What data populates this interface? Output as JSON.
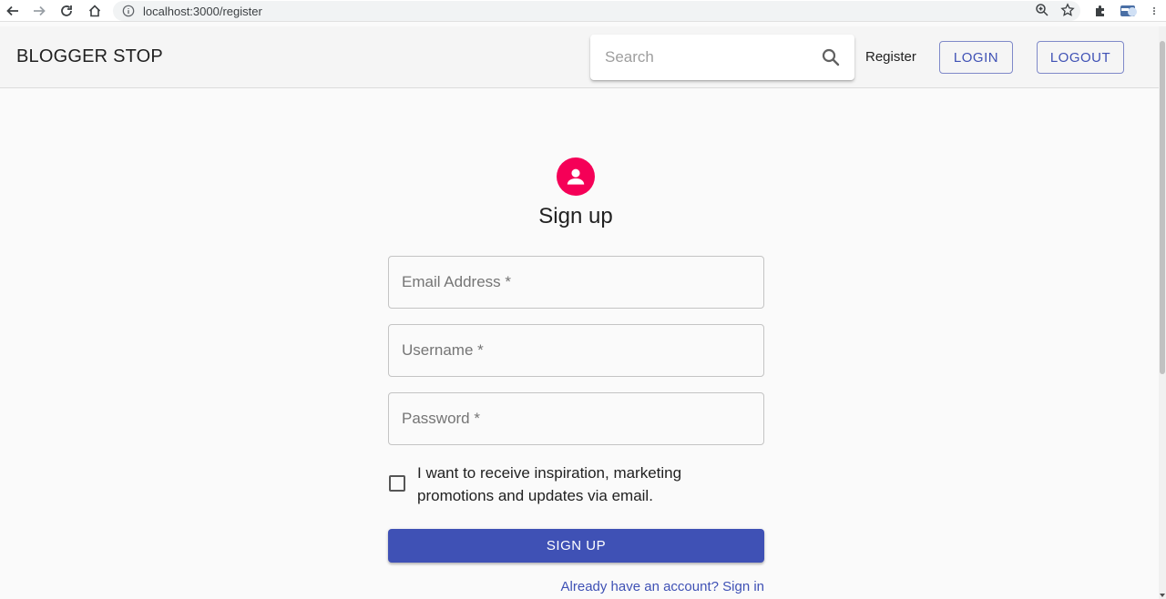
{
  "browser": {
    "url": "localhost:3000/register",
    "icons": [
      "back-icon",
      "forward-icon",
      "reload-icon",
      "home-icon",
      "info-icon",
      "zoom-icon",
      "star-icon",
      "extensions-icon",
      "profile-icon",
      "menu-icon"
    ]
  },
  "appbar": {
    "brand": "BLOGGER STOP",
    "search_placeholder": "Search",
    "register_label": "Register",
    "login_label": "LOGIN",
    "logout_label": "LOGOUT"
  },
  "form": {
    "title": "Sign up",
    "email_placeholder": "Email Address *",
    "username_placeholder": "Username *",
    "password_placeholder": "Password *",
    "checkbox_label": "I want to receive inspiration, marketing promotions and updates via email.",
    "checkbox_checked": false,
    "submit_label": "SIGN UP",
    "signin_link": "Already have an account? Sign in"
  },
  "colors": {
    "primary": "#3f51b5",
    "secondary": "#f50057"
  }
}
